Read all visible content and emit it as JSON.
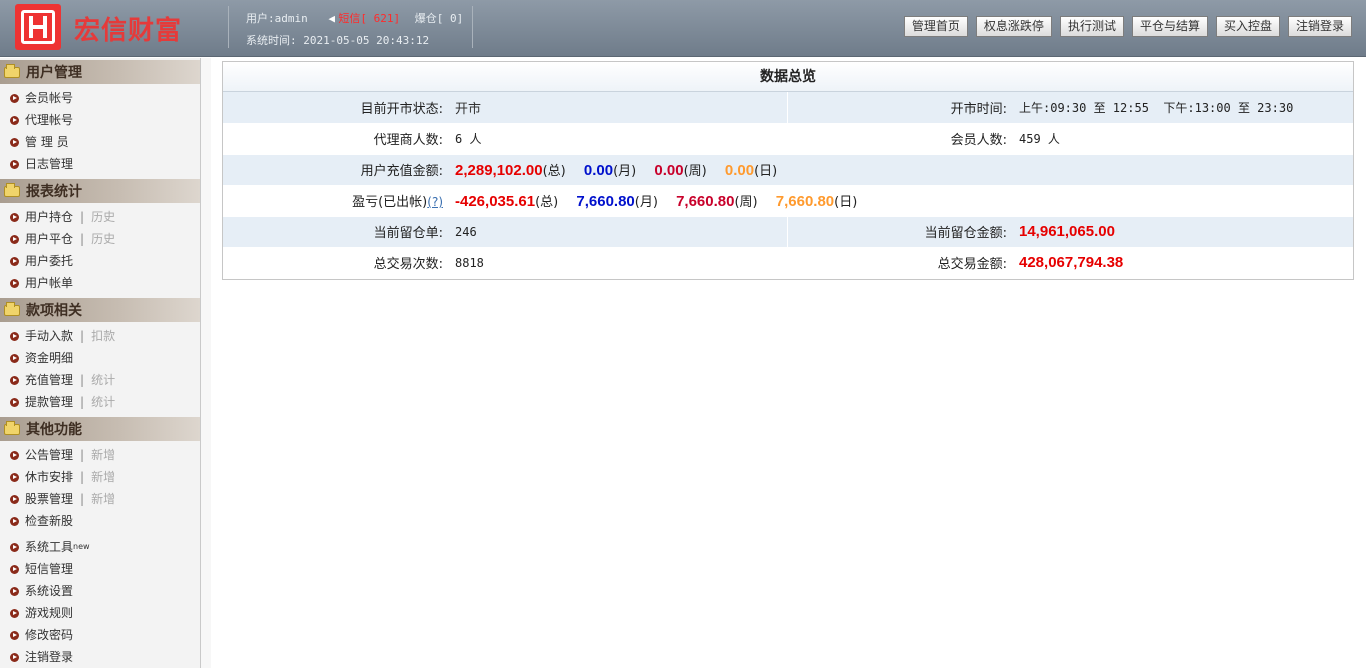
{
  "header": {
    "logo_text": "宏信财富",
    "user": "用户:admin",
    "sms_label": "短信[ 621]",
    "liquidation": "爆仓[ 0]",
    "system_time": "系统时间: 2021-05-05 20:43:12",
    "buttons": [
      "管理首页",
      "权息涨跌停",
      "执行测试",
      "平仓与结算",
      "买入控盘",
      "注销登录"
    ]
  },
  "sidebar": {
    "sections": [
      {
        "title": "用户管理",
        "items": [
          {
            "label": "会员帐号"
          },
          {
            "label": "代理帐号"
          },
          {
            "label": "管 理 员"
          },
          {
            "label": "日志管理"
          }
        ]
      },
      {
        "title": "报表统计",
        "items": [
          {
            "label": "用户持仓",
            "sub": "历史"
          },
          {
            "label": "用户平仓",
            "sub": "历史"
          },
          {
            "label": "用户委托"
          },
          {
            "label": "用户帐单"
          }
        ]
      },
      {
        "title": "款项相关",
        "items": [
          {
            "label": "手动入款",
            "sub": "扣款"
          },
          {
            "label": "资金明细"
          },
          {
            "label": "充值管理",
            "sub": "统计"
          },
          {
            "label": "提款管理",
            "sub": "统计"
          }
        ]
      },
      {
        "title": "其他功能",
        "items": [
          {
            "label": "公告管理",
            "sub": "新增"
          },
          {
            "label": "休市安排",
            "sub": "新增"
          },
          {
            "label": "股票管理",
            "sub": "新增"
          },
          {
            "label": "检查新股"
          },
          {
            "label": "系统工具",
            "badge": "new"
          },
          {
            "label": "短信管理"
          },
          {
            "label": "系统设置"
          },
          {
            "label": "游戏规则"
          },
          {
            "label": "修改密码"
          },
          {
            "label": "注销登录"
          }
        ]
      }
    ]
  },
  "main": {
    "title": "数据总览",
    "market_status_label": "目前开市状态:",
    "market_status": "开市",
    "open_time_label": "开市时间:",
    "open_time": "上午:09:30 至 12:55  下午:13:00 至 23:30",
    "agent_count_label": "代理商人数:",
    "agent_count": "6 人",
    "member_count_label": "会员人数:",
    "member_count": "459 人",
    "recharge_label": "用户充值金额:",
    "recharge": {
      "total": "2,289,102.00",
      "month": "0.00",
      "week": "0.00",
      "day": "0.00"
    },
    "profit_label": "盈亏(已出帐)",
    "profit_help": "(?)",
    "profit": {
      "total": "-426,035.61",
      "month": "7,660.80",
      "week": "7,660.80",
      "day": "7,660.80"
    },
    "units": {
      "total": "(总)",
      "month": "(月)",
      "week": "(周)",
      "day": "(日)"
    },
    "positions_label": "当前留仓单:",
    "positions": "246",
    "positions_amount_label": "当前留仓金额:",
    "positions_amount": "14,961,065.00",
    "trade_count_label": "总交易次数:",
    "trade_count": "8818",
    "trade_amount_label": "总交易金额:",
    "trade_amount": "428,067,794.38"
  }
}
